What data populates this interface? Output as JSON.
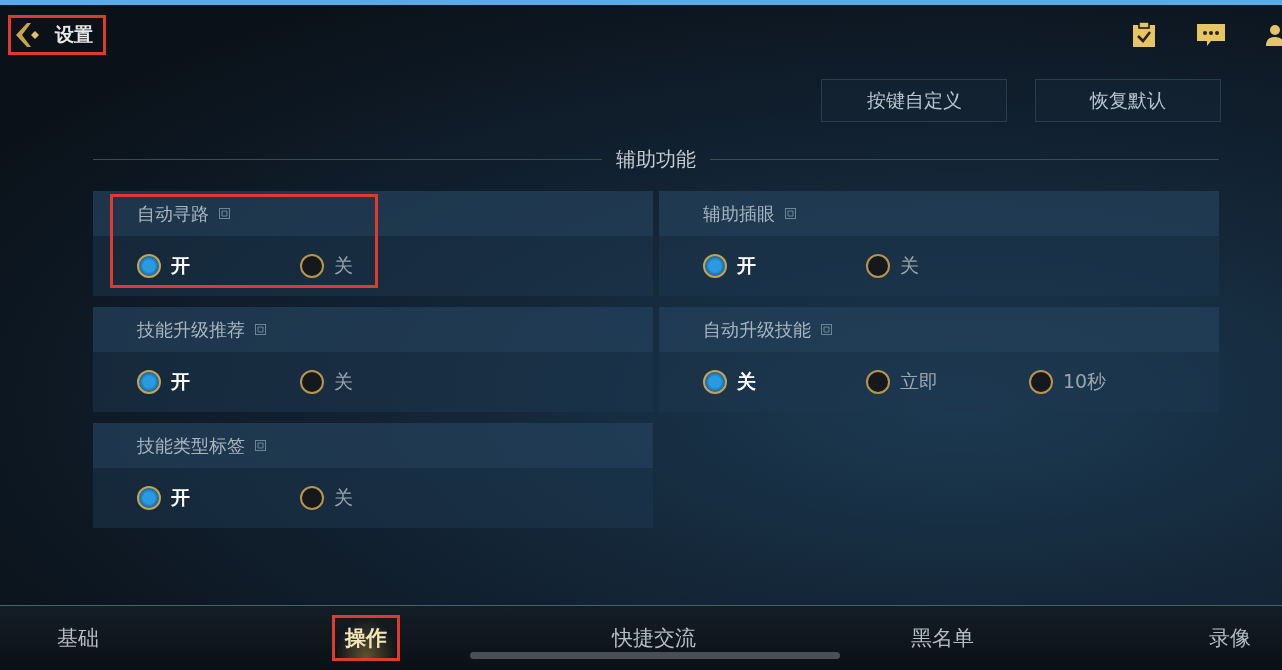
{
  "header": {
    "title": "设置",
    "annotated": true
  },
  "actions": [
    "按键自定义",
    "恢复默认"
  ],
  "section": {
    "title": "辅助功能"
  },
  "settings": [
    {
      "title": "自动寻路",
      "annotated": true,
      "options": [
        {
          "label": "开",
          "selected": true
        },
        {
          "label": "关",
          "selected": false
        }
      ]
    },
    {
      "title": "辅助插眼",
      "annotated": false,
      "options": [
        {
          "label": "开",
          "selected": true
        },
        {
          "label": "关",
          "selected": false
        }
      ]
    },
    {
      "title": "技能升级推荐",
      "annotated": false,
      "options": [
        {
          "label": "开",
          "selected": true
        },
        {
          "label": "关",
          "selected": false
        }
      ]
    },
    {
      "title": "自动升级技能",
      "annotated": false,
      "options": [
        {
          "label": "关",
          "selected": true
        },
        {
          "label": "立即",
          "selected": false
        },
        {
          "label": "10秒",
          "selected": false
        }
      ]
    },
    {
      "title": "技能类型标签",
      "annotated": false,
      "options": [
        {
          "label": "开",
          "selected": true
        },
        {
          "label": "关",
          "selected": false
        }
      ]
    }
  ],
  "tabs": [
    {
      "label": "基础",
      "selected": false,
      "annotated": false
    },
    {
      "label": "操作",
      "selected": true,
      "annotated": true
    },
    {
      "label": "快捷交流",
      "selected": false,
      "annotated": false
    },
    {
      "label": "黑名单",
      "selected": false,
      "annotated": false
    },
    {
      "label": "录像",
      "selected": false,
      "annotated": false
    }
  ]
}
